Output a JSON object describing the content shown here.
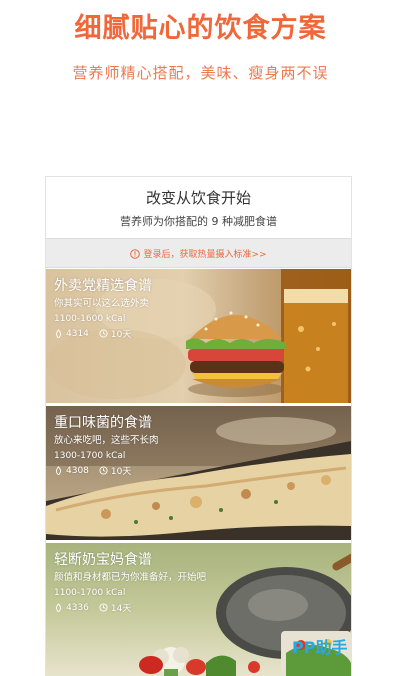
{
  "header": {
    "title": "细腻贴心的饮食方案",
    "subtitle": "营养师精心搭配，美味、瘦身两不误"
  },
  "intro": {
    "title": "改变从饮食开始",
    "subtitle_prefix": "营养师为你搭配的",
    "subtitle_count": "9",
    "subtitle_suffix": "种减肥食谱"
  },
  "login_bar": {
    "text": "登录后，获取热量摄入标准>>",
    "icon": "warning-icon"
  },
  "cards": [
    {
      "title": "外卖党精选食谱",
      "desc": "你其实可以这么选外卖",
      "kcal": "1100-1600 kCal",
      "users": "4314",
      "days": "10天"
    },
    {
      "title": "重口味菌的食谱",
      "desc": "放心来吃吧，这些不长肉",
      "kcal": "1300-1700 kCal",
      "users": "4308",
      "days": "10天"
    },
    {
      "title": "轻断奶宝妈食谱",
      "desc": "颜值和身材都已为你准备好，开始吧",
      "kcal": "1100-1700 kCal",
      "users": "4336",
      "days": "14天"
    }
  ],
  "watermark": "PP助手",
  "colors": {
    "accent": "#f0683a",
    "login_text": "#e86a3c",
    "watermark": "#2aa8e0"
  }
}
